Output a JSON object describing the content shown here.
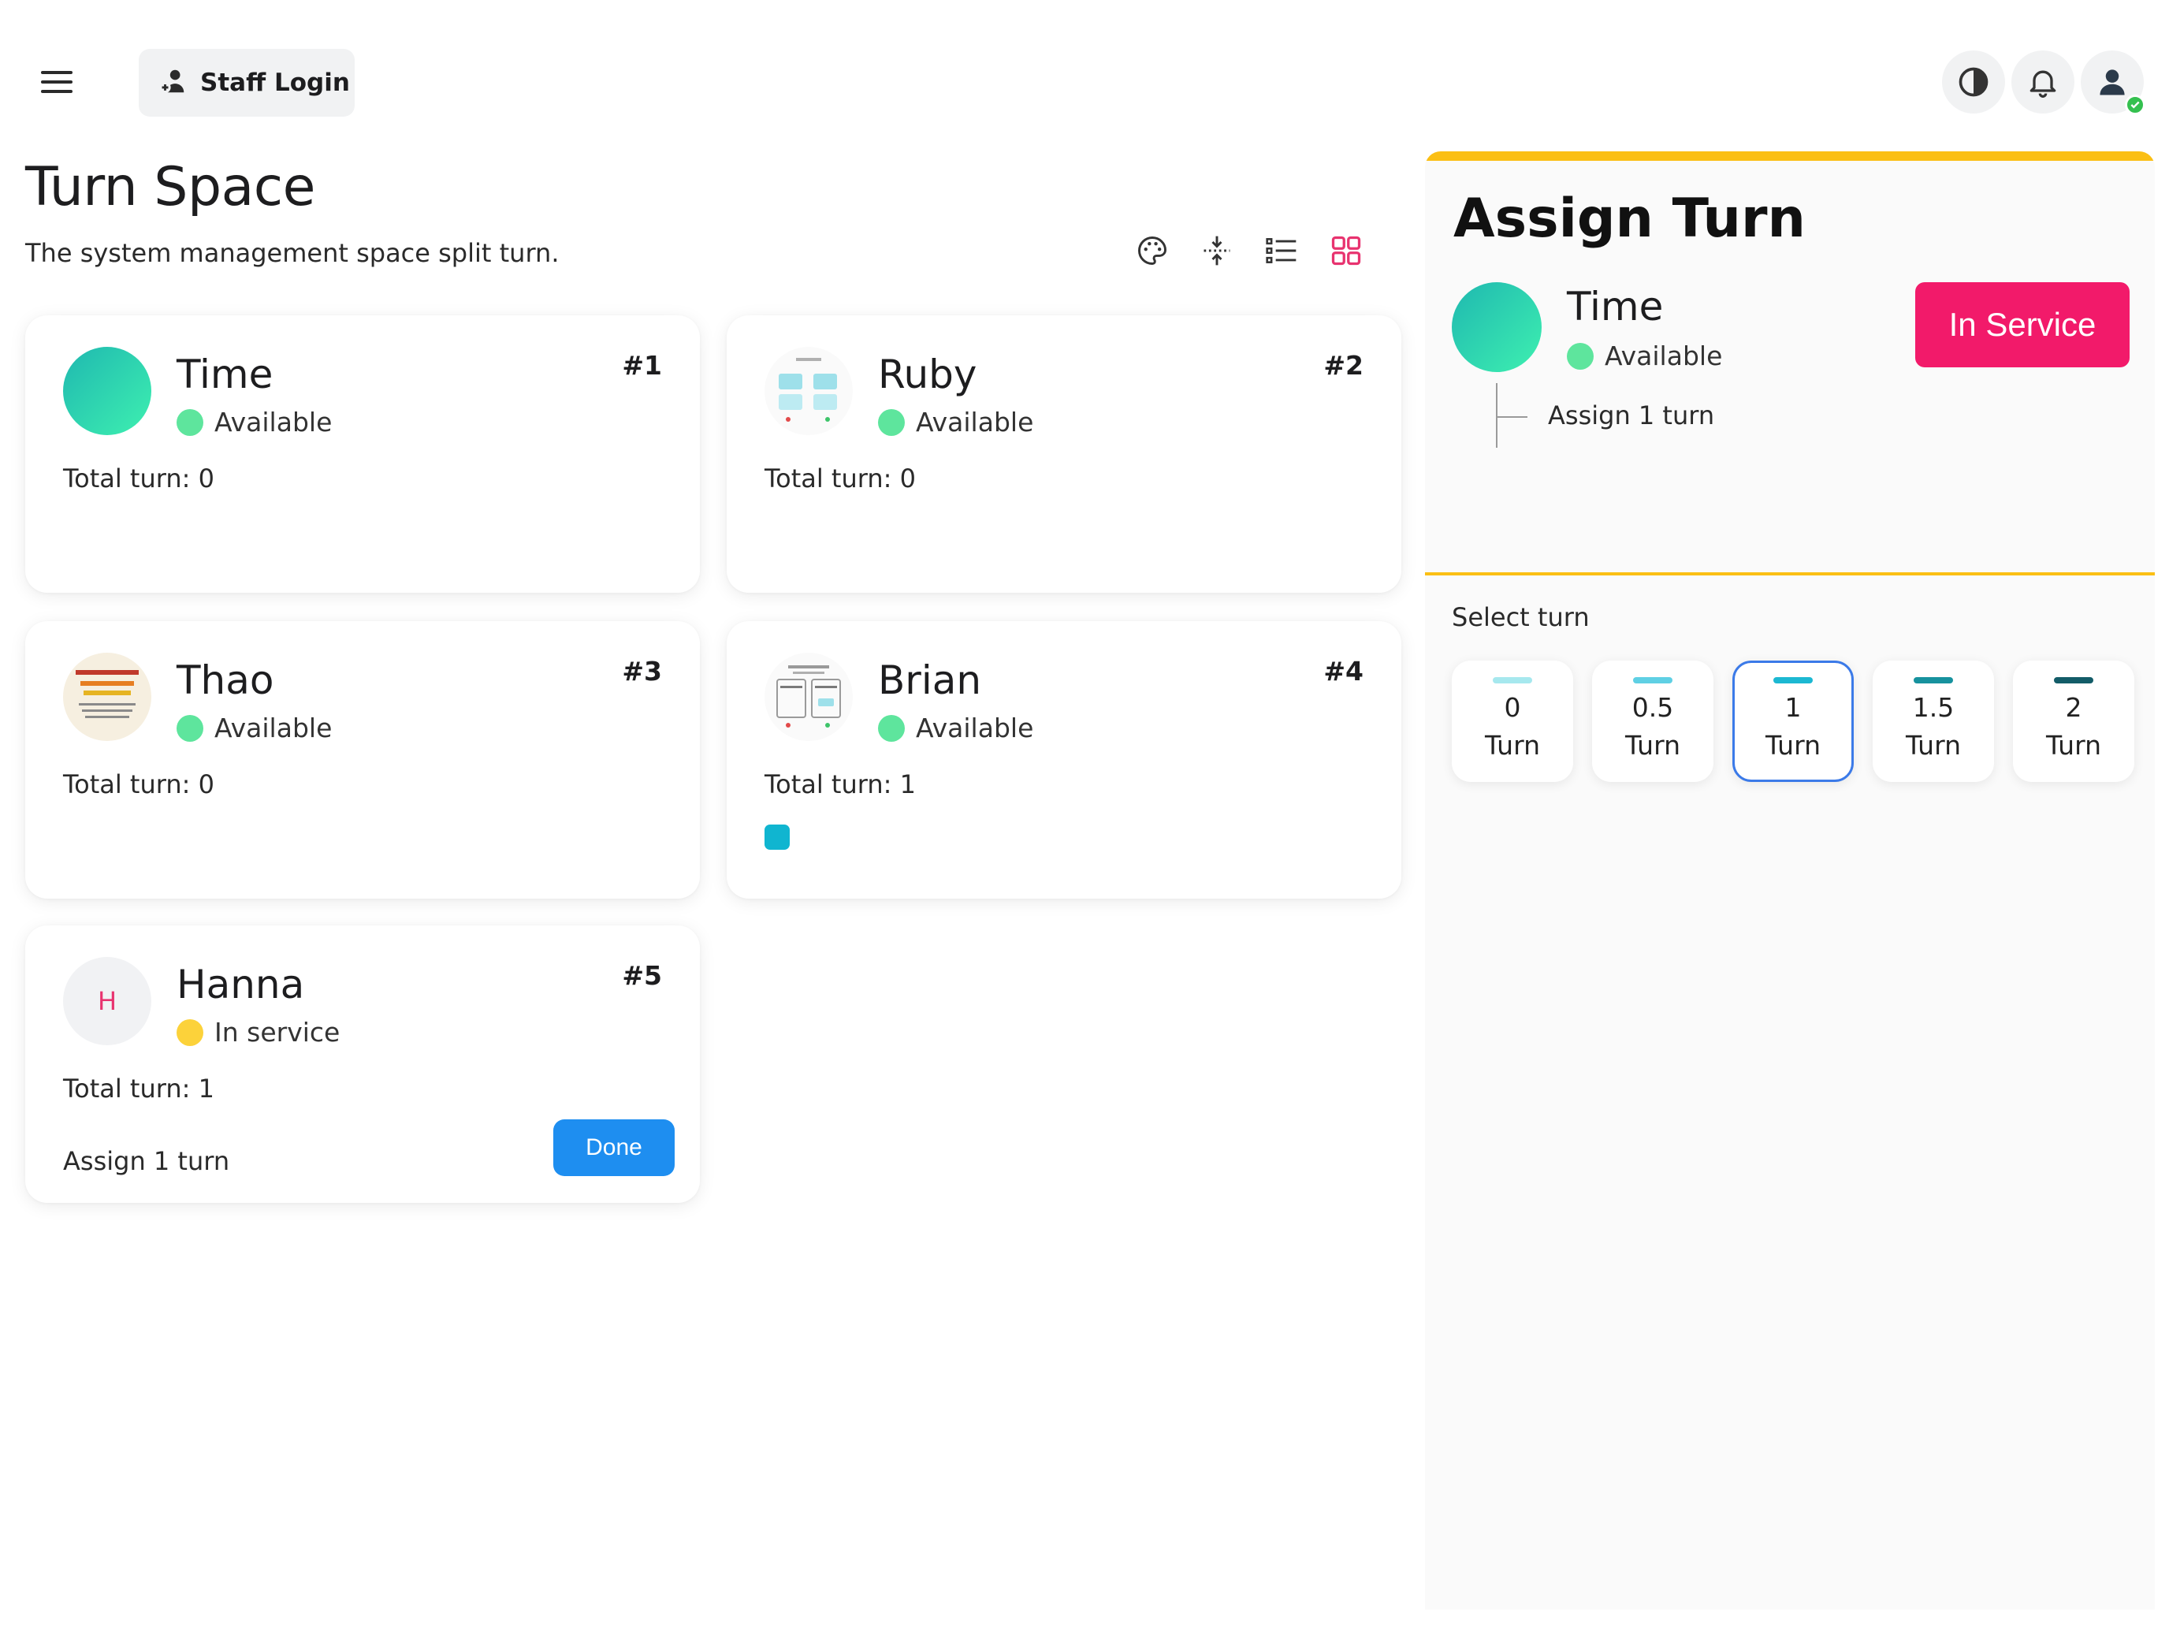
{
  "header": {
    "staff_login_label": "Staff Login"
  },
  "page": {
    "title": "Turn Space",
    "subtitle": "The system management space split turn."
  },
  "colors": {
    "accent": "#fbbf14",
    "available": "#5ee59d",
    "in_service": "#fcd23a",
    "in_service_button": "#f21a6a",
    "done_button": "#1e8ef0",
    "grid_view_active": "#e8336f"
  },
  "staff": [
    {
      "name": "Time",
      "status": "Available",
      "number": "#1",
      "total": "Total turn: 0",
      "avatar": "gradient"
    },
    {
      "name": "Ruby",
      "status": "Available",
      "number": "#2",
      "total": "Total turn: 0",
      "avatar": "thumbnail"
    },
    {
      "name": "Thao",
      "status": "Available",
      "number": "#3",
      "total": "Total turn: 0",
      "avatar": "thumbnail"
    },
    {
      "name": "Brian",
      "status": "Available",
      "number": "#4",
      "total": "Total turn: 1",
      "avatar": "thumbnail"
    },
    {
      "name": "Hanna",
      "status": "In service",
      "number": "#5",
      "total": "Total turn: 1",
      "avatar_letter": "H",
      "assign": "Assign 1 turn",
      "done_label": "Done"
    }
  ],
  "panel": {
    "title": "Assign Turn",
    "name": "Time",
    "status": "Available",
    "assign": "Assign 1 turn",
    "in_service_label": "In Service",
    "select_label": "Select turn",
    "turn_options": [
      {
        "value": "0",
        "unit": "Turn",
        "color": "#a6e8ee"
      },
      {
        "value": "0.5",
        "unit": "Turn",
        "color": "#5fd0e4"
      },
      {
        "value": "1",
        "unit": "Turn",
        "color": "#1cb8d2",
        "selected": true
      },
      {
        "value": "1.5",
        "unit": "Turn",
        "color": "#17929e"
      },
      {
        "value": "2",
        "unit": "Turn",
        "color": "#135c68"
      }
    ]
  }
}
